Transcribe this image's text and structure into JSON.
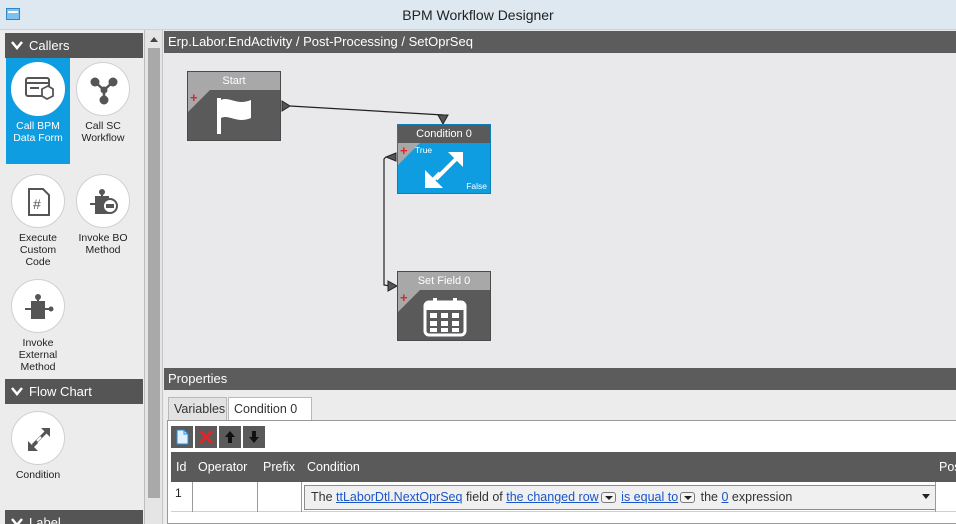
{
  "window": {
    "title": "BPM Workflow Designer"
  },
  "toolbox": {
    "groups": [
      {
        "label": "Callers"
      },
      {
        "label": "Flow Chart"
      },
      {
        "label": "Label"
      }
    ],
    "callers": [
      {
        "label": "Call BPM Data Form",
        "selected": true,
        "icon": "form-icon"
      },
      {
        "label": "Call SC Workflow",
        "selected": false,
        "icon": "workflow-icon"
      },
      {
        "label": "Execute Custom Code",
        "selected": false,
        "icon": "code-file-icon"
      },
      {
        "label": "Invoke BO Method",
        "selected": false,
        "icon": "bo-method-icon"
      },
      {
        "label": "Invoke External Method",
        "selected": false,
        "icon": "external-method-icon"
      }
    ],
    "flowchart": [
      {
        "label": "Condition",
        "icon": "condition-icon"
      }
    ]
  },
  "breadcrumb": "Erp.Labor.EndActivity / Post-Processing / SetOprSeq",
  "canvas": {
    "nodes": [
      {
        "id": "start",
        "title": "Start",
        "icon": "flag-icon"
      },
      {
        "id": "condition",
        "title": "Condition 0",
        "icon": "condition-icon",
        "true_label": "True",
        "false_label": "False",
        "selected": true
      },
      {
        "id": "setfield",
        "title": "Set Field 0",
        "icon": "calendar-grid-icon"
      }
    ],
    "connections": [
      {
        "from": "Start",
        "to": "Condition 0"
      },
      {
        "from": "Condition 0",
        "to": "Set Field 0",
        "branch": "True"
      }
    ]
  },
  "properties": {
    "header": "Properties",
    "tabs": [
      {
        "label": "Variables",
        "active": false
      },
      {
        "label": "Condition 0",
        "active": true
      }
    ],
    "toolbar": [
      "new-icon",
      "delete-icon",
      "move-up-icon",
      "move-down-icon"
    ],
    "columns": [
      "Id",
      "Operator",
      "Prefix",
      "Condition",
      "Pos"
    ],
    "rows": [
      {
        "id": "1",
        "operator": "",
        "prefix": "",
        "condition": {
          "t1": "The ",
          "field": "ttLaborDtl.NextOprSeq",
          "t2": " field of ",
          "row": "the changed row",
          "op": "is equal to",
          "t3": " the ",
          "value": "0",
          "t4": " expression"
        }
      }
    ]
  }
}
